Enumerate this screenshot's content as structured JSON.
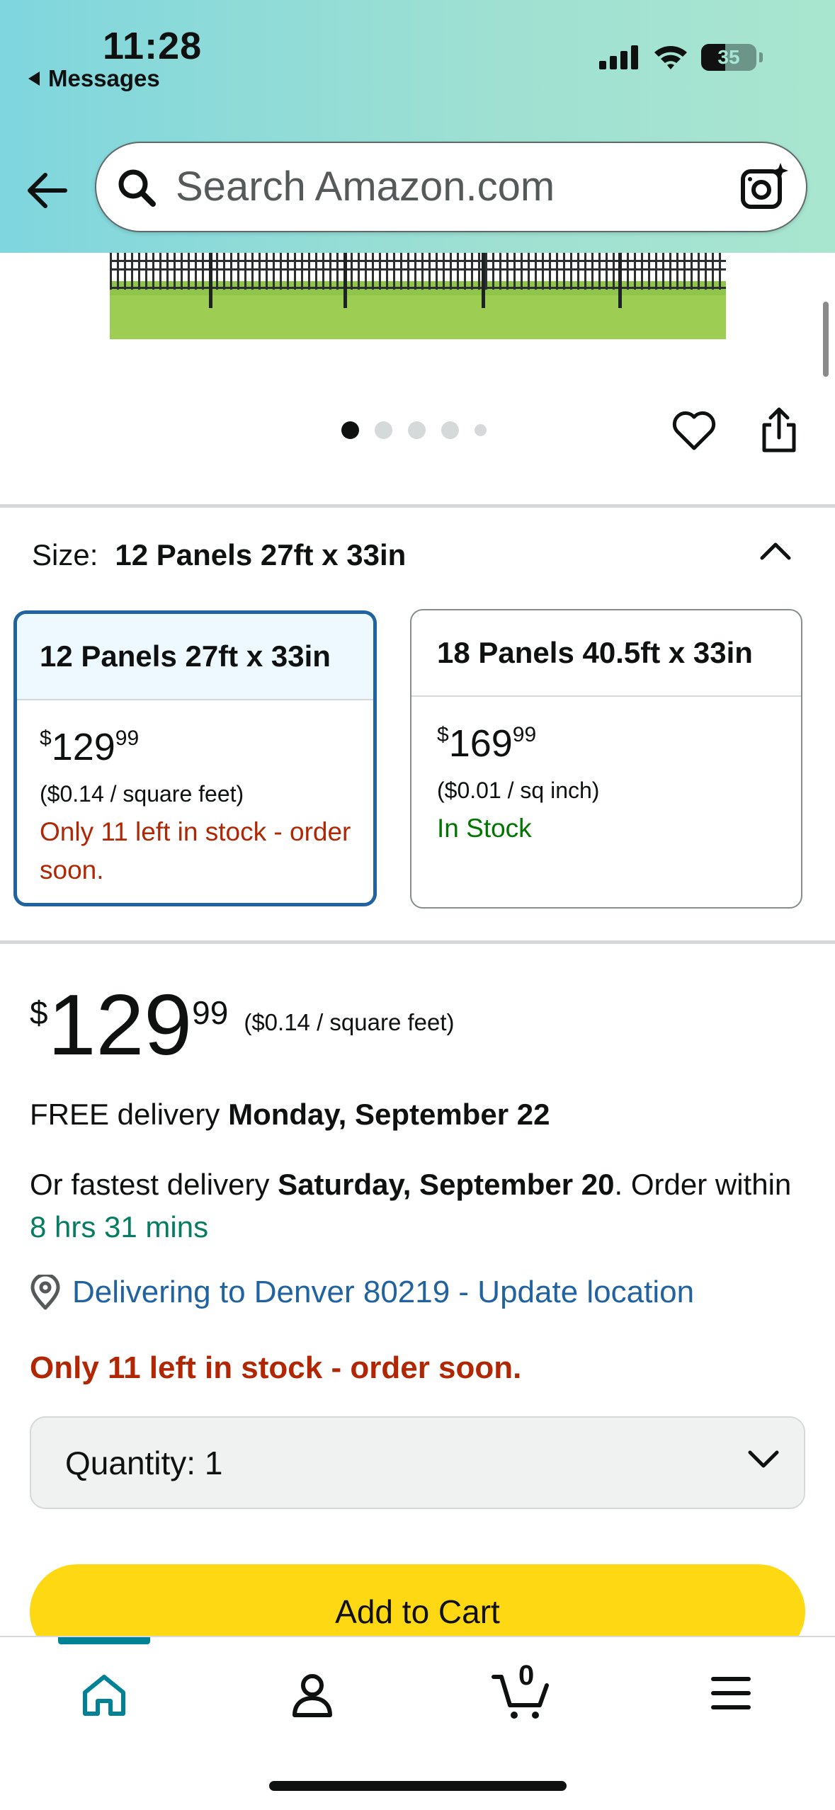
{
  "status_bar": {
    "time": "11:28",
    "back_app": "Messages",
    "battery": "35"
  },
  "search": {
    "placeholder": "Search Amazon.com"
  },
  "carousel": {
    "page_count": 5,
    "active_index": 0
  },
  "size": {
    "label": "Size:",
    "selected": "12 Panels 27ft x 33in",
    "options": [
      {
        "name": "12 Panels 27ft x 33in",
        "price_symbol": "$",
        "price_whole": "129",
        "price_cents": "99",
        "unit_price": "($0.14 / square feet)",
        "stock": "Only 11 left in stock - order soon.",
        "selected": true
      },
      {
        "name": "18 Panels 40.5ft x 33in",
        "price_symbol": "$",
        "price_whole": "169",
        "price_cents": "99",
        "unit_price": "($0.01 / sq inch)",
        "stock": "In Stock",
        "selected": false
      }
    ]
  },
  "price": {
    "symbol": "$",
    "whole": "129",
    "cents": "99",
    "unit": "($0.14 / square feet)"
  },
  "delivery": {
    "free_prefix": "FREE delivery ",
    "free_date": "Monday, September 22",
    "fastest_prefix": "Or fastest delivery ",
    "fastest_date": "Saturday, September 20",
    "order_mid": ". Order within ",
    "countdown": "8 hrs 31 mins"
  },
  "location": {
    "text": "Delivering to Denver 80219 - Update location"
  },
  "stock_message": "Only 11 left in stock - order soon.",
  "quantity": {
    "label": "Quantity:",
    "value": "1"
  },
  "add_to_cart": "Add to Cart",
  "cart_count": "0",
  "colors": {
    "accent_blue": "#2162a1",
    "stock_red": "#b12704",
    "in_stock_green": "#007600",
    "cart_yellow": "#ffd814",
    "nav_teal": "#008296"
  },
  "icons": [
    "back-arrow-icon",
    "search-icon",
    "camera-icon",
    "heart-icon",
    "share-icon",
    "chevron-up-icon",
    "location-pin-icon",
    "chevron-down-icon",
    "home-icon",
    "account-icon",
    "cart-icon",
    "menu-icon"
  ]
}
